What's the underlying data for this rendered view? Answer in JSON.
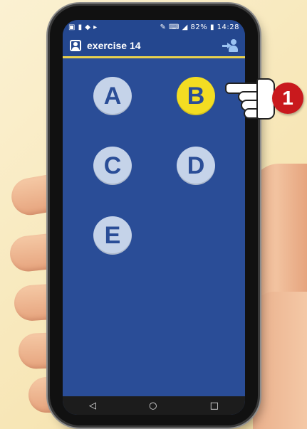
{
  "status_bar": {
    "left_icons": "▣ ▮ ◆ ▸",
    "right_icons": "✎ ⌨ ◢",
    "battery": "82%",
    "time": "14:28"
  },
  "app_bar": {
    "title": "exercise 14",
    "app_icon": "person-card-icon",
    "action_icon": "switch-user-icon"
  },
  "options": [
    {
      "label": "A",
      "selected": false
    },
    {
      "label": "B",
      "selected": true
    },
    {
      "label": "C",
      "selected": false
    },
    {
      "label": "D",
      "selected": false
    },
    {
      "label": "E",
      "selected": false
    }
  ],
  "nav": {
    "back": "◁",
    "home": "○",
    "recent": "□"
  },
  "callout": {
    "step": "1"
  },
  "colors": {
    "screen_bg": "#2a4d97",
    "header_underline": "#e9d24d",
    "selected_option": "#f3dd22",
    "option_bg": "#c5d3e9",
    "badge": "#c9191d"
  }
}
